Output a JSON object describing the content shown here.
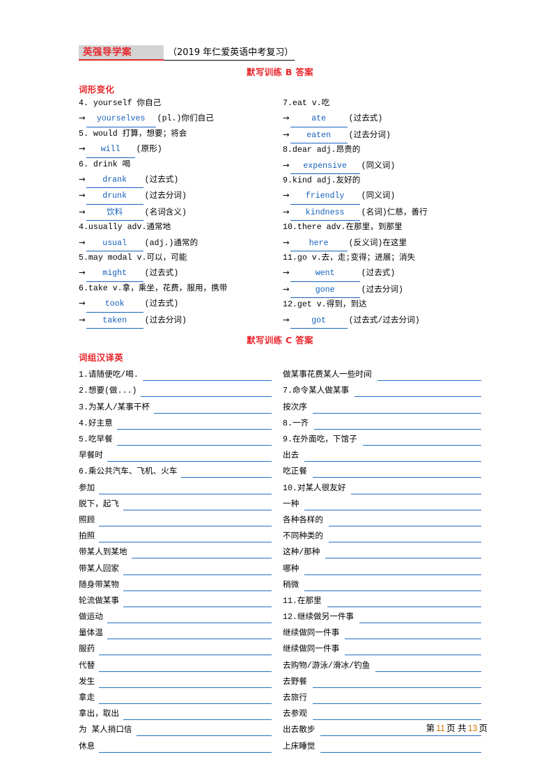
{
  "header": {
    "brand": "英强导学案",
    "subtitle": "（2019 年仁爱英语中考复习）"
  },
  "section_b": {
    "title": "默写训练 B 答案",
    "subsection_title": "词形变化",
    "left_entries": [
      {
        "head": "4.  yourself 你自己"
      },
      {
        "arrow": "→",
        "answer": "yourselves",
        "note": "(pl.)你们自己",
        "w": "w1"
      },
      {
        "head": "5.  would 打算，想要；将会"
      },
      {
        "arrow": "→",
        "answer": "will",
        "note": "(原形)",
        "w": "w2"
      },
      {
        "head": "6.  drink 喝"
      },
      {
        "arrow": "→",
        "answer": "drank",
        "note": "(过去式)",
        "w": "w3"
      },
      {
        "arrow": "→",
        "answer": "drunk",
        "note": "(过去分词)",
        "w": "w3"
      },
      {
        "arrow": "→",
        "answer": "饮料",
        "note": "(名词含义)",
        "w": "w3"
      },
      {
        "head": "4.usually adv.通常地"
      },
      {
        "arrow": "→",
        "answer": "usual",
        "note": "(adj.)通常的",
        "w": "w3"
      },
      {
        "head": "5.may  modal v.可以，可能"
      },
      {
        "arrow": "→",
        "answer": "might",
        "note": "(过去式)",
        "w": "w3"
      },
      {
        "head": "6.take  v.拿，乘坐，花费，服用，携带"
      },
      {
        "arrow": "→",
        "answer": "took",
        "note": "(过去式)",
        "w": "w3"
      },
      {
        "arrow": "→",
        "answer": "taken",
        "note": "(过去分词)",
        "w": "w3"
      }
    ],
    "right_entries": [
      {
        "head": "7.eat  v.吃"
      },
      {
        "arrow": "→",
        "answer": "ate",
        "note": "(过去式)",
        "w": "w3"
      },
      {
        "arrow": "→",
        "answer": "eaten",
        "note": "(过去分词)",
        "w": "w3"
      },
      {
        "head": "8.dear  adj.昂贵的"
      },
      {
        "arrow": "→",
        "answer": "expensive",
        "note": "(同义词)",
        "w": "w1"
      },
      {
        "head": "9.kind  adj.友好的"
      },
      {
        "arrow": "→",
        "answer": "friendly",
        "note": "(同义词)",
        "w": "w1"
      },
      {
        "arrow": "→",
        "answer": "kindness",
        "note": "(名词)仁慈，善行",
        "w": "w1"
      },
      {
        "head": "10.there adv.在那里，到那里"
      },
      {
        "arrow": "→",
        "answer": "here",
        "note": "(反义词)在这里",
        "w": "w3"
      },
      {
        "head": "11.go  v.去，走;变得；进展；消失"
      },
      {
        "arrow": "→",
        "answer": "went",
        "note": "(过去式)",
        "w": "w1"
      },
      {
        "arrow": "→",
        "answer": "gone",
        "note": "(过去分词)",
        "w": "w1"
      },
      {
        "head": "12.get  v.得到，到达"
      },
      {
        "arrow": "→",
        "answer": "got",
        "note": "(过去式/过去分词)",
        "w": "w3"
      }
    ]
  },
  "section_c": {
    "title": "默写训练 C 答案",
    "subsection_title": "词组汉译英",
    "left_items": [
      "1.请随便吃/喝.",
      "2.想要(做...)",
      "3.为某人/某事干杯",
      "4.好主意",
      "5.吃早餐",
      "早餐时",
      "6.乘公共汽车、飞机、火车",
      "参加",
      "脱下，起飞",
      "照顾",
      "拍照",
      "带某人到某地",
      "带某人回家",
      "随身带某物",
      "轮流做某事",
      "做运动",
      "量体温",
      "服药",
      "代替",
      "发生",
      "拿走",
      "拿出，取出",
      "为 某人捎口信",
      "休息"
    ],
    "right_items": [
      "做某事花费某人一些时间",
      "7.命令某人做某事",
      "按次序",
      "8.一齐",
      "9.在外面吃，下馆子",
      "出去",
      "吃正餐",
      "10.对某人很友好",
      "一种",
      "各种各样的",
      "不同种类的",
      "这种/那种",
      "哪种",
      "稍微",
      "11.在那里",
      "12.继续做另一件事",
      "继续做同一件事",
      "继续做同一件事",
      "去购物/游泳/滑冰/钓鱼",
      "去野餐",
      "去旅行",
      "去参观",
      "出去散步",
      "上床睡觉"
    ]
  },
  "footer": {
    "prefix": "第",
    "current_page": "11",
    "middle": "页 共",
    "total_pages": "13",
    "suffix": "页"
  }
}
